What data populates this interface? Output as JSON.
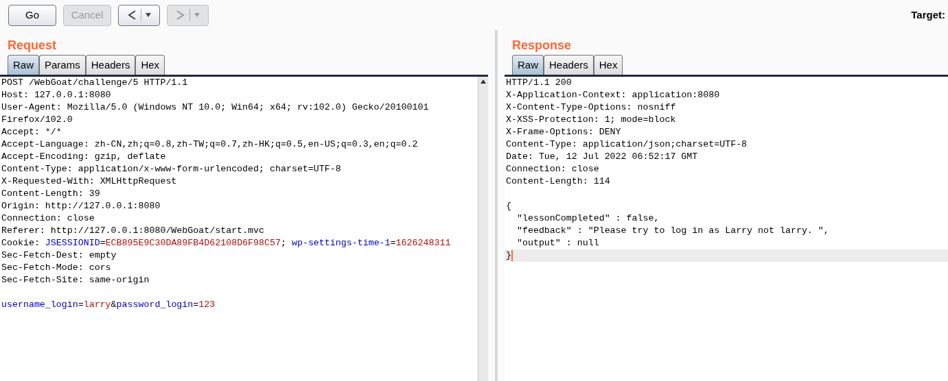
{
  "toolbar": {
    "buttons": [
      {
        "label": "Go",
        "disabled": false
      },
      {
        "label": "Cancel",
        "disabled": true
      }
    ],
    "nav_buttons": [
      {
        "kind": "back",
        "disabled": false
      },
      {
        "kind": "forward",
        "disabled": true
      }
    ],
    "target_label": "Target:"
  },
  "request": {
    "title": "Request",
    "tabs": [
      {
        "label": "Raw",
        "selected": true
      },
      {
        "label": "Params",
        "selected": false
      },
      {
        "label": "Headers",
        "selected": false
      },
      {
        "label": "Hex",
        "selected": false
      }
    ],
    "lines": [
      {
        "kind": "plain",
        "text": "POST /WebGoat/challenge/5 HTTP/1.1"
      },
      {
        "kind": "plain",
        "text": "Host: 127.0.0.1:8080"
      },
      {
        "kind": "plain",
        "text": "User-Agent: Mozilla/5.0 (Windows NT 10.0; Win64; x64; rv:102.0) Gecko/20100101"
      },
      {
        "kind": "plain",
        "text": "Firefox/102.0"
      },
      {
        "kind": "plain",
        "text": "Accept: */*"
      },
      {
        "kind": "plain",
        "text": "Accept-Language: zh-CN,zh;q=0.8,zh-TW;q=0.7,zh-HK;q=0.5,en-US;q=0.3,en;q=0.2"
      },
      {
        "kind": "plain",
        "text": "Accept-Encoding: gzip, deflate"
      },
      {
        "kind": "plain",
        "text": "Content-Type: application/x-www-form-urlencoded; charset=UTF-8"
      },
      {
        "kind": "plain",
        "text": "X-Requested-With: XMLHttpRequest"
      },
      {
        "kind": "plain",
        "text": "Content-Length: 39"
      },
      {
        "kind": "plain",
        "text": "Origin: http://127.0.0.1:8080"
      },
      {
        "kind": "plain",
        "text": "Connection: close"
      },
      {
        "kind": "plain",
        "text": "Referer: http://127.0.0.1:8080/WebGoat/start.mvc"
      },
      {
        "kind": "rich",
        "segments": [
          {
            "kind": "plain",
            "text": "Cookie: "
          },
          {
            "kind": "name",
            "text": "JSESSIONID"
          },
          {
            "kind": "plain",
            "text": "="
          },
          {
            "kind": "value",
            "text": "ECB895E9C30DA89FB4D62108D6F98C57"
          },
          {
            "kind": "plain",
            "text": "; "
          },
          {
            "kind": "name",
            "text": "wp-settings-time-1"
          },
          {
            "kind": "plain",
            "text": "="
          },
          {
            "kind": "value",
            "text": "1626248311"
          }
        ]
      },
      {
        "kind": "plain",
        "text": "Sec-Fetch-Dest: empty"
      },
      {
        "kind": "plain",
        "text": "Sec-Fetch-Mode: cors"
      },
      {
        "kind": "plain",
        "text": "Sec-Fetch-Site: same-origin"
      },
      {
        "kind": "blank"
      },
      {
        "kind": "rich",
        "segments": [
          {
            "kind": "name",
            "text": "username_login"
          },
          {
            "kind": "plain",
            "text": "="
          },
          {
            "kind": "value",
            "text": "larry"
          },
          {
            "kind": "plain",
            "text": "&"
          },
          {
            "kind": "name",
            "text": "password_login"
          },
          {
            "kind": "plain",
            "text": "="
          },
          {
            "kind": "value",
            "text": "123"
          }
        ]
      }
    ]
  },
  "response": {
    "title": "Response",
    "tabs": [
      {
        "label": "Raw",
        "selected": true
      },
      {
        "label": "Headers",
        "selected": false
      },
      {
        "label": "Hex",
        "selected": false
      }
    ],
    "lines": [
      {
        "kind": "plain",
        "text": "HTTP/1.1 200",
        "current": false
      },
      {
        "kind": "plain",
        "text": "X-Application-Context: application:8080",
        "current": false
      },
      {
        "kind": "plain",
        "text": "X-Content-Type-Options: nosniff",
        "current": false
      },
      {
        "kind": "plain",
        "text": "X-XSS-Protection: 1; mode=block",
        "current": false
      },
      {
        "kind": "plain",
        "text": "X-Frame-Options: DENY",
        "current": false
      },
      {
        "kind": "plain",
        "text": "Content-Type: application/json;charset=UTF-8",
        "current": false
      },
      {
        "kind": "plain",
        "text": "Date: Tue, 12 Jul 2022 06:52:17 GMT",
        "current": false
      },
      {
        "kind": "plain",
        "text": "Connection: close",
        "current": false
      },
      {
        "kind": "plain",
        "text": "Content-Length: 114",
        "current": false
      },
      {
        "kind": "blank",
        "current": false
      },
      {
        "kind": "plain",
        "text": "{",
        "current": false
      },
      {
        "kind": "plain",
        "text": "  \"lessonCompleted\" : false,",
        "current": false
      },
      {
        "kind": "plain",
        "text": "  \"feedback\" : \"Please try to log in as Larry not larry. \",",
        "current": false
      },
      {
        "kind": "plain",
        "text": "  \"output\" : null",
        "current": false
      },
      {
        "kind": "plain",
        "text": "}",
        "current": true
      }
    ]
  }
}
